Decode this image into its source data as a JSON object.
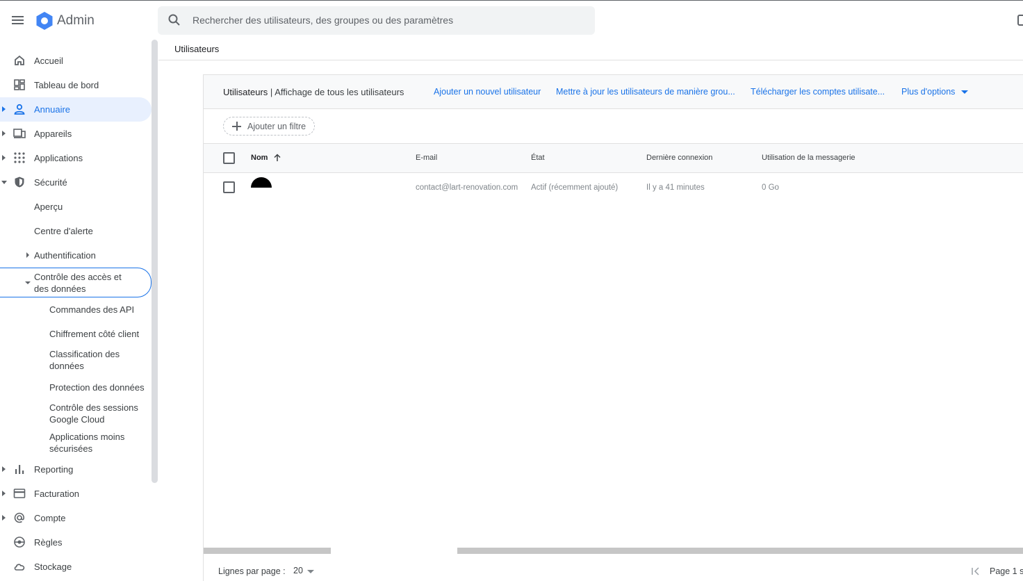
{
  "topbar": {
    "app_title": "Admin",
    "search_placeholder": "Rechercher des utilisateurs, des groupes ou des paramètres"
  },
  "sidebar": {
    "items": [
      {
        "label": "Accueil",
        "icon": "home-icon"
      },
      {
        "label": "Tableau de bord",
        "icon": "dashboard-icon"
      },
      {
        "label": "Annuaire",
        "icon": "person-icon",
        "active": true
      },
      {
        "label": "Appareils",
        "icon": "devices-icon"
      },
      {
        "label": "Applications",
        "icon": "apps-grid-icon"
      },
      {
        "label": "Sécurité",
        "icon": "shield-icon",
        "expanded": true
      },
      {
        "label": "Reporting",
        "icon": "bar-chart-icon"
      },
      {
        "label": "Facturation",
        "icon": "credit-card-icon"
      },
      {
        "label": "Compte",
        "icon": "at-sign-icon"
      },
      {
        "label": "Règles",
        "icon": "rules-icon"
      },
      {
        "label": "Stockage",
        "icon": "cloud-icon"
      }
    ],
    "security_sub": {
      "apercu": "Aperçu",
      "centre_alerte": "Centre d'alerte",
      "authentification": "Authentification",
      "controle_acces": "Contrôle des accès et des données",
      "controle_children": [
        "Commandes des API",
        "Chiffrement côté client",
        "Classification des données",
        "Protection des données",
        "Contrôle des sessions Google Cloud",
        "Applications moins sécurisées"
      ]
    }
  },
  "breadcrumb": "Utilisateurs",
  "card": {
    "title": "Utilisateurs",
    "subtitle": "| Affichage de tous les utilisateurs",
    "actions": [
      "Ajouter un nouvel utilisateur",
      "Mettre à jour les utilisateurs de manière grou...",
      "Télécharger les comptes utilisate...",
      "Plus d'options"
    ],
    "filter_label": "Ajouter un filtre"
  },
  "table": {
    "columns": [
      "Nom",
      "E-mail",
      "État",
      "Dernière connexion",
      "Utilisation de la messagerie"
    ],
    "rows": [
      {
        "name": "",
        "email": "contact@lart-renovation.com",
        "status": "Actif (récemment ajouté)",
        "last_login": "Il y a 41 minutes",
        "mail_usage": "0 Go"
      }
    ]
  },
  "footer": {
    "rows_per_page_label": "Lignes par page :",
    "rows_per_page_value": "20",
    "page_label": "Page 1 s"
  },
  "colors": {
    "accent": "#1a73e8",
    "active_bg": "#e8f0fe"
  }
}
